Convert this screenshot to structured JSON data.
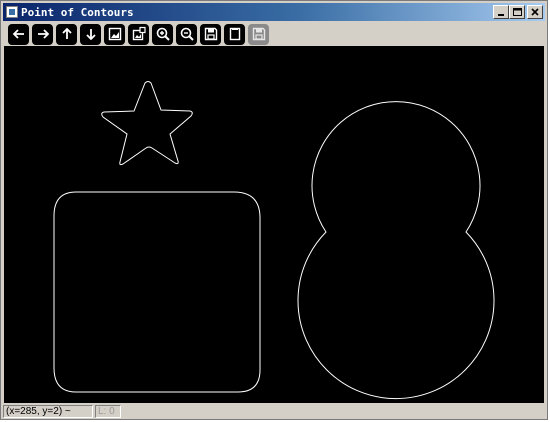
{
  "window": {
    "title": "Point of Contours",
    "controls": {
      "minimize": "_",
      "maximize": "□",
      "close": "×"
    }
  },
  "toolbar": {
    "buttons": [
      {
        "name": "back",
        "icon": "arrow-left-icon",
        "enabled": true
      },
      {
        "name": "forward",
        "icon": "arrow-right-icon",
        "enabled": true
      },
      {
        "name": "up",
        "icon": "arrow-up-icon",
        "enabled": true
      },
      {
        "name": "down",
        "icon": "arrow-down-icon",
        "enabled": true
      },
      {
        "name": "image",
        "icon": "image-icon",
        "enabled": true
      },
      {
        "name": "image-properties",
        "icon": "image-settings-icon",
        "enabled": true
      },
      {
        "name": "zoom-in",
        "icon": "zoom-in-icon",
        "enabled": true
      },
      {
        "name": "zoom-out",
        "icon": "zoom-out-icon",
        "enabled": true
      },
      {
        "name": "save",
        "icon": "save-icon",
        "enabled": true
      },
      {
        "name": "copy",
        "icon": "copy-icon",
        "enabled": true
      },
      {
        "name": "save-disabled",
        "icon": "save-icon",
        "enabled": false
      }
    ]
  },
  "canvas": {
    "background": "#000000",
    "stroke": "#ffffff",
    "shapes": [
      "star",
      "rounded-square",
      "figure-eight"
    ]
  },
  "status": {
    "coords": "(x=285, y=2) ~",
    "extra": "L: 0"
  },
  "colors": {
    "titlebar_start": "#0a246a",
    "titlebar_end": "#a6caf0",
    "chrome": "#d4d0c8"
  }
}
